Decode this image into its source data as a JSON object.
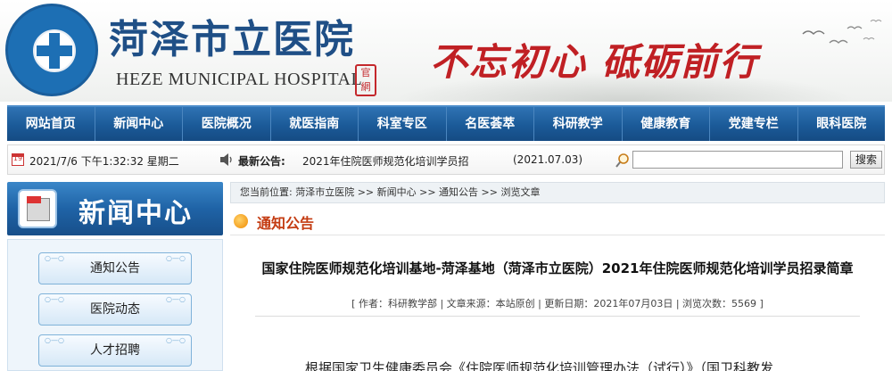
{
  "header": {
    "hospital_name": "菏泽市立医院",
    "hospital_name_en": "HEZE MUNICIPAL HOSPITAL",
    "seal_text": "官網",
    "slogan": "不忘初心 砥砺前行",
    "logo_ring_text": "HEZE MUNICIPAL HOSPITAL"
  },
  "nav": {
    "items": [
      {
        "label": "网站首页"
      },
      {
        "label": "新闻中心"
      },
      {
        "label": "医院概况"
      },
      {
        "label": "就医指南"
      },
      {
        "label": "科室专区"
      },
      {
        "label": "名医荟萃"
      },
      {
        "label": "科研教学"
      },
      {
        "label": "健康教育"
      },
      {
        "label": "党建专栏"
      },
      {
        "label": "眼科医院"
      }
    ]
  },
  "infobar": {
    "datetime": "2021/7/6 下午1:32:32 星期二",
    "latest_label": "最新公告:",
    "latest_title": "2021年住院医师规范化培训学员招",
    "latest_date": "(2021.07.03)",
    "search_placeholder": "",
    "search_button": "搜索",
    "calendar_day": "19"
  },
  "sidebar": {
    "title": "新闻中心",
    "items": [
      {
        "label": "通知公告"
      },
      {
        "label": "医院动态"
      },
      {
        "label": "人才招聘"
      }
    ]
  },
  "main": {
    "breadcrumb": "您当前位置: 菏泽市立医院 >> 新闻中心 >> 通知公告 >> 浏览文章",
    "section_title": "通知公告",
    "article_title": "国家住院医师规范化培训基地-菏泽基地（菏泽市立医院）2021年住院医师规范化培训学员招录简章",
    "article_meta": "[ 作者：科研教学部 | 文章来源：本站原创 | 更新日期：2021年07月03日 | 浏览次数：5569 ]",
    "article_body": "根据国家卫生健康委员会《住院医师规范化培训管理办法（试行）》（国卫科教发"
  },
  "colors": {
    "nav_blue": "#1b5a98",
    "slogan_red": "#c02024",
    "section_orange": "#c43c12",
    "hospital_blue": "#1f4f86"
  }
}
